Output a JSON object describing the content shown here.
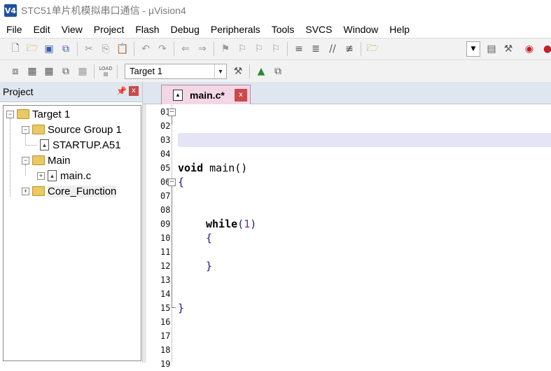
{
  "window": {
    "title": "STC51单片机模拟串口通信  - µVision4",
    "icon_label": "V4"
  },
  "menu": [
    "File",
    "Edit",
    "View",
    "Project",
    "Flash",
    "Debug",
    "Peripherals",
    "Tools",
    "SVCS",
    "Window",
    "Help"
  ],
  "toolbar2": {
    "target_value": "Target 1",
    "load_label": "LOAD"
  },
  "project_panel": {
    "title": "Project",
    "tree": {
      "target": "Target 1",
      "group1": "Source Group 1",
      "group1_file": "STARTUP.A51",
      "group2": "Main",
      "group2_file": "main.c",
      "group3": "Core_Function"
    }
  },
  "editor": {
    "tab_label": "main.c*",
    "line_numbers": [
      "01",
      "02",
      "03",
      "04",
      "05",
      "06",
      "07",
      "08",
      "09",
      "10",
      "11",
      "12",
      "13",
      "14",
      "15",
      "16",
      "17",
      "18",
      "19"
    ],
    "code": {
      "kw_void": "void",
      "fn_main": " main",
      "parens": "()",
      "brace_open": "{",
      "kw_while": "while",
      "paren_open": "(",
      "num_one": "1",
      "paren_close": ")",
      "inner_open": "{",
      "inner_close": "}",
      "brace_close": "}"
    }
  },
  "colors": {
    "accent_tab": "#f3d7e6",
    "close_red": "#c94a4a",
    "current_line": "#e4e4f7",
    "panel_header": "#dfe6ef"
  },
  "icons": [
    "new-file-icon",
    "open-folder-icon",
    "save-icon",
    "save-all-icon",
    "cut-icon",
    "copy-icon",
    "paste-icon",
    "undo-icon",
    "redo-icon",
    "nav-back-icon",
    "nav-forward-icon",
    "bookmark-icon",
    "indent-icon",
    "unindent-icon",
    "comment-icon",
    "find-icon",
    "debug-icon"
  ]
}
